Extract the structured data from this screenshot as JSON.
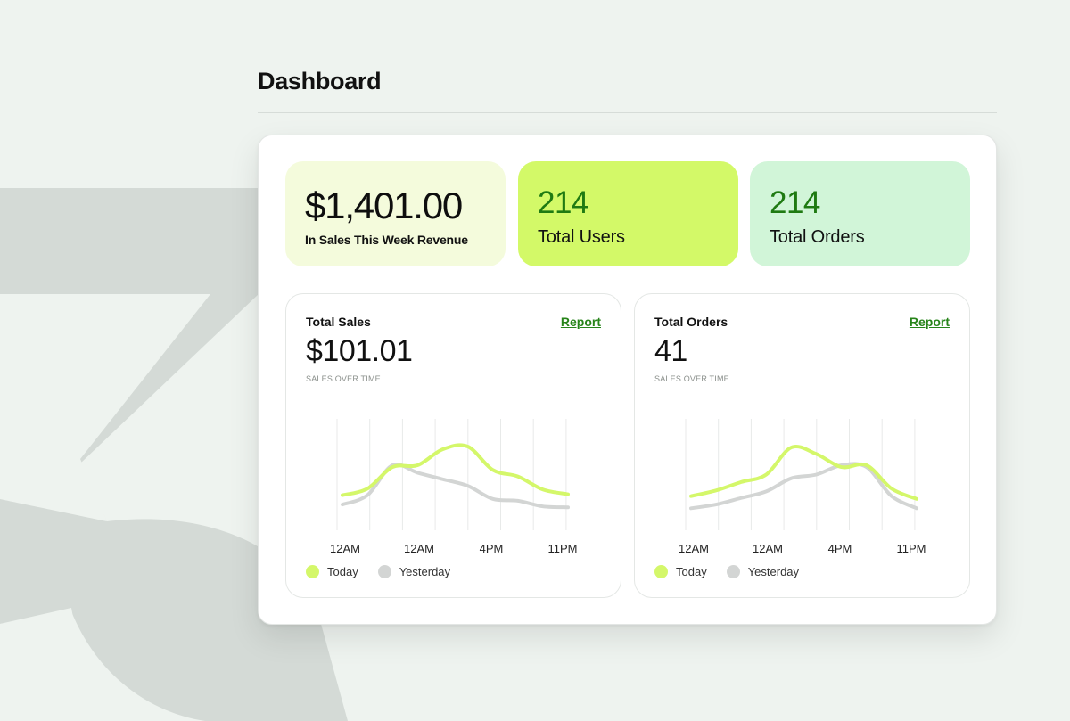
{
  "page": {
    "title": "Dashboard"
  },
  "stats": [
    {
      "value": "$1,401.00",
      "label": "In Sales This Week Revenue"
    },
    {
      "value": "214",
      "label": "Total Users"
    },
    {
      "value": "214",
      "label": "Total Orders"
    }
  ],
  "cards": [
    {
      "title": "Total Sales",
      "report": "Report",
      "value": "$101.01",
      "subtitle": "SALES OVER TIME"
    },
    {
      "title": "Total Orders",
      "report": "Report",
      "value": "41",
      "subtitle": "SALES OVER TIME"
    }
  ],
  "colors": {
    "today": "#d4f76a",
    "yesterday": "#d3d5d4",
    "accent_green": "#27841a"
  },
  "chart_data": [
    {
      "type": "line",
      "x_ticks": [
        "12AM",
        "12AM",
        "4PM",
        "11PM"
      ],
      "grid": "vertical",
      "legend_position": "bottom-left",
      "series": [
        {
          "name": "Today",
          "values": [
            0.28,
            0.35,
            0.58,
            0.6,
            0.77,
            0.8,
            0.55,
            0.48,
            0.34,
            0.29
          ]
        },
        {
          "name": "Yesterday",
          "values": [
            0.18,
            0.28,
            0.6,
            0.52,
            0.45,
            0.38,
            0.24,
            0.22,
            0.16,
            0.15
          ]
        }
      ]
    },
    {
      "type": "line",
      "x_ticks": [
        "12AM",
        "12AM",
        "4PM",
        "11PM"
      ],
      "grid": "vertical",
      "legend_position": "bottom-left",
      "series": [
        {
          "name": "Today",
          "values": [
            0.27,
            0.33,
            0.42,
            0.5,
            0.79,
            0.72,
            0.58,
            0.6,
            0.35,
            0.24
          ]
        },
        {
          "name": "Yesterday",
          "values": [
            0.14,
            0.18,
            0.25,
            0.32,
            0.46,
            0.5,
            0.6,
            0.58,
            0.27,
            0.14
          ]
        }
      ]
    }
  ]
}
